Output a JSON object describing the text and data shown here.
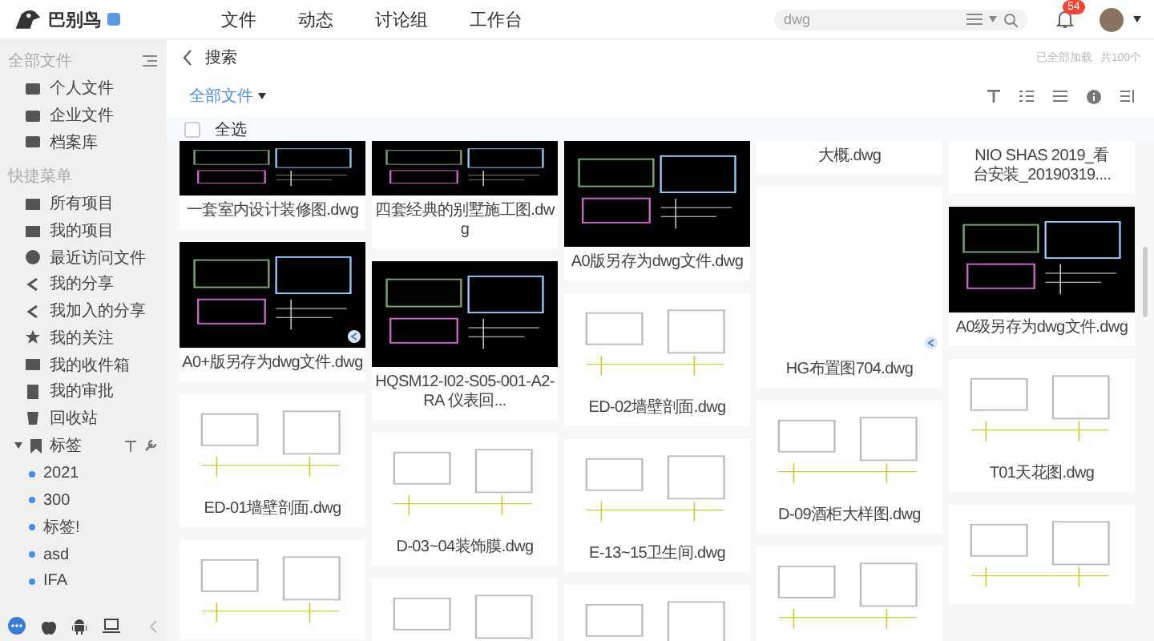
{
  "brand": {
    "name": "巴别鸟"
  },
  "nav": [
    "文件",
    "动态",
    "讨论组",
    "工作台"
  ],
  "search": {
    "value": "dwg"
  },
  "notifications": {
    "count": "54"
  },
  "sidebar": {
    "sections": [
      {
        "title": "全部文件",
        "items": [
          {
            "label": "个人文件"
          },
          {
            "label": "企业文件"
          },
          {
            "label": "档案库"
          }
        ]
      },
      {
        "title": "快捷菜单",
        "items": [
          {
            "label": "所有项目"
          },
          {
            "label": "我的项目"
          },
          {
            "label": "最近访问文件"
          },
          {
            "label": "我的分享"
          },
          {
            "label": "我加入的分享"
          },
          {
            "label": "我的关注"
          },
          {
            "label": "我的收件箱"
          },
          {
            "label": "我的审批"
          },
          {
            "label": "回收站"
          }
        ]
      }
    ],
    "tags": {
      "title": "标签",
      "expanded": true,
      "items": [
        {
          "label": "2021",
          "color": "#4a90e2"
        },
        {
          "label": "300",
          "color": "#4a90e2"
        },
        {
          "label": "标签!",
          "color": "#4a90e2"
        },
        {
          "label": "asd",
          "color": "#4a90e2"
        },
        {
          "label": "IFA",
          "color": "#4a90e2"
        }
      ]
    }
  },
  "header": {
    "title": "搜索",
    "status": "已全部加载",
    "count": "共100个"
  },
  "filter": {
    "label": "全部文件"
  },
  "select_all": {
    "label": "全选",
    "checked": false
  },
  "columns": [
    [
      {
        "kind": "partial",
        "name": "一套室内设计装修图.dwg",
        "shared": false
      },
      {
        "kind": "dark",
        "name": "A0+版另存为dwg文件.dwg",
        "shared": true
      },
      {
        "kind": "light",
        "name": "ED-01墙壁剖面.dwg",
        "shared": false
      },
      {
        "kind": "light"
      }
    ],
    [
      {
        "kind": "partial",
        "name": "四套经典的别墅施工图.dwg",
        "shared": false
      },
      {
        "kind": "dark",
        "name": "HQSM12-I02-S05-001-A2-RA 仪表回...",
        "shared": false
      },
      {
        "kind": "light",
        "name": "D-03~04装饰膜.dwg",
        "shared": false
      },
      {
        "kind": "light"
      }
    ],
    [
      {
        "kind": "dark",
        "name": "A0版另存为dwg文件.dwg",
        "shared": false
      },
      {
        "kind": "light",
        "name": "ED-02墙壁剖面.dwg",
        "shared": false
      },
      {
        "kind": "light",
        "name": "E-13~15卫生间.dwg",
        "shared": false
      },
      {
        "kind": "light"
      }
    ],
    [
      {
        "kind": "caption",
        "name": "大概.dwg",
        "shared": false
      },
      {
        "kind": "blank",
        "name": "HG布置图704.dwg",
        "shared": true
      },
      {
        "kind": "light",
        "name": "D-09酒柜大样图.dwg",
        "shared": false
      },
      {
        "kind": "light"
      }
    ],
    [
      {
        "kind": "caption",
        "name": "NIO SHAS 2019_看台安装_20190319....",
        "shared": false
      },
      {
        "kind": "dark",
        "name": "A0级另存为dwg文件.dwg",
        "shared": false
      },
      {
        "kind": "light",
        "name": "T01天花图.dwg",
        "shared": false
      },
      {
        "kind": "light"
      }
    ]
  ]
}
